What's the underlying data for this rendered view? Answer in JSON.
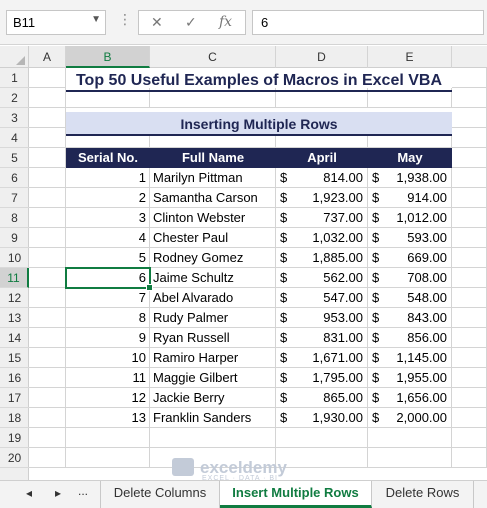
{
  "formula_bar": {
    "name_box": "B11",
    "formula_value": "6",
    "cancel_glyph": "✕",
    "enter_glyph": "✓",
    "fx_glyph": "fx"
  },
  "columns": [
    "A",
    "B",
    "C",
    "D",
    "E"
  ],
  "rows": [
    "1",
    "2",
    "3",
    "4",
    "5",
    "6",
    "7",
    "8",
    "9",
    "10",
    "11",
    "12",
    "13",
    "14",
    "15",
    "16",
    "17",
    "18",
    "19",
    "20"
  ],
  "sheet": {
    "title": "Top 50 Useful Examples of Macros in Excel VBA",
    "subtitle": "Inserting Multiple Rows",
    "headers": [
      "Serial No.",
      "Full Name",
      "April",
      "May"
    ],
    "currency": "$",
    "records": [
      {
        "serial": "1",
        "name": "Marilyn Pittman",
        "april": "814.00",
        "may": "1,938.00"
      },
      {
        "serial": "2",
        "name": "Samantha Carson",
        "april": "1,923.00",
        "may": "914.00"
      },
      {
        "serial": "3",
        "name": "Clinton Webster",
        "april": "737.00",
        "may": "1,012.00"
      },
      {
        "serial": "4",
        "name": "Chester Paul",
        "april": "1,032.00",
        "may": "593.00"
      },
      {
        "serial": "5",
        "name": "Rodney Gomez",
        "april": "1,885.00",
        "may": "669.00"
      },
      {
        "serial": "6",
        "name": "Jaime Schultz",
        "april": "562.00",
        "may": "708.00"
      },
      {
        "serial": "7",
        "name": "Abel Alvarado",
        "april": "547.00",
        "may": "548.00"
      },
      {
        "serial": "8",
        "name": "Rudy Palmer",
        "april": "953.00",
        "may": "843.00"
      },
      {
        "serial": "9",
        "name": "Ryan Russell",
        "april": "831.00",
        "may": "856.00"
      },
      {
        "serial": "10",
        "name": "Ramiro Harper",
        "april": "1,671.00",
        "may": "1,145.00"
      },
      {
        "serial": "11",
        "name": "Maggie Gilbert",
        "april": "1,795.00",
        "may": "1,955.00"
      },
      {
        "serial": "12",
        "name": "Jackie Berry",
        "april": "865.00",
        "may": "1,656.00"
      },
      {
        "serial": "13",
        "name": "Franklin Sanders",
        "april": "1,930.00",
        "may": "2,000.00"
      }
    ]
  },
  "tabs": {
    "more": "...",
    "items": [
      {
        "label": "Delete Columns",
        "active": false
      },
      {
        "label": "Insert Multiple Rows",
        "active": true
      },
      {
        "label": "Delete Rows",
        "active": false
      }
    ]
  },
  "watermark": {
    "brand": "exceldemy",
    "tagline": "EXCEL · DATA · BI"
  },
  "colors": {
    "header_bg": "#1f2653",
    "banner_bg": "#d9dff2",
    "accent": "#107c41"
  }
}
